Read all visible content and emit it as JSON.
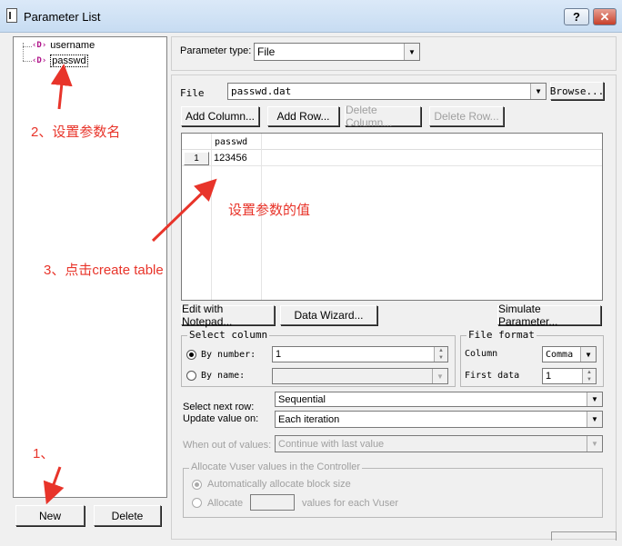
{
  "window": {
    "title": "Parameter List",
    "help_label": "?",
    "close_label": "✕"
  },
  "tree": {
    "items": [
      {
        "label": "username"
      },
      {
        "label": "passwd"
      }
    ]
  },
  "left_buttons": {
    "new_label": "New",
    "delete_label": "Delete"
  },
  "parameter_type": {
    "label": "Parameter type:",
    "value": "File"
  },
  "file": {
    "label": "File",
    "value": "passwd.dat",
    "browse_label": "Browse..."
  },
  "table_buttons": {
    "add_column": "Add Column...",
    "add_row": "Add Row...",
    "delete_column": "Delete Column...",
    "delete_row": "Delete Row..."
  },
  "table": {
    "columns": [
      "passwd"
    ],
    "rows": [
      {
        "num": "1",
        "cells": [
          "123456"
        ]
      }
    ]
  },
  "action_buttons": {
    "notepad": "Edit with Notepad...",
    "wizard": "Data Wizard...",
    "simulate": "Simulate Parameter..."
  },
  "select_column": {
    "title": "Select column",
    "by_number_label": "By number:",
    "by_number_value": "1",
    "by_name_label": "By name:"
  },
  "file_format": {
    "title": "File format",
    "column_label": "Column",
    "column_value": "Comma",
    "first_data_label": "First data",
    "first_data_value": "1"
  },
  "next_row": {
    "label": "Select next row:",
    "value": "Sequential"
  },
  "update_value": {
    "label": "Update value on:",
    "value": "Each iteration"
  },
  "out_of_values": {
    "label": "When out of values:",
    "value": "Continue with last value"
  },
  "allocate": {
    "title": "Allocate Vuser values in the Controller",
    "auto_label": "Automatically allocate block size",
    "allocate_label": "Allocate",
    "suffix_label": "values for each Vuser"
  },
  "annotations": {
    "step1": "1、",
    "step2": "2、设置参数名",
    "step3": "3、点击create table",
    "value_note": "设置参数的值"
  },
  "colors": {
    "annotation": "#e8342a",
    "param_icon": "#b0148a"
  }
}
